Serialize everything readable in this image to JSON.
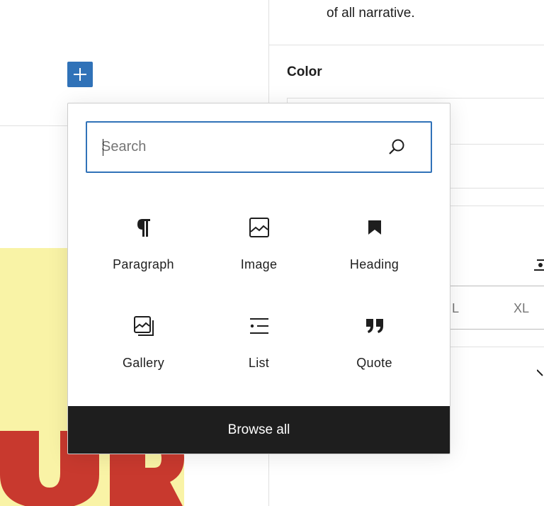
{
  "sidebar": {
    "truncated_text": "of all narrative.",
    "color_heading": "Color",
    "size_options": [
      "L",
      "XL"
    ]
  },
  "inserter": {
    "search": {
      "placeholder": "Search",
      "value": ""
    },
    "blocks": [
      {
        "label": "Paragraph",
        "icon": "paragraph-icon"
      },
      {
        "label": "Image",
        "icon": "image-icon"
      },
      {
        "label": "Heading",
        "icon": "heading-bookmark-icon"
      },
      {
        "label": "Gallery",
        "icon": "gallery-icon"
      },
      {
        "label": "List",
        "icon": "list-icon"
      },
      {
        "label": "Quote",
        "icon": "quote-icon"
      }
    ],
    "browse_all_label": "Browse all"
  },
  "colors": {
    "accent": "#3072b8",
    "dark": "#1e1e1e",
    "cover_background": "#f9f3a6",
    "cover_lettering": "#c8392e"
  }
}
